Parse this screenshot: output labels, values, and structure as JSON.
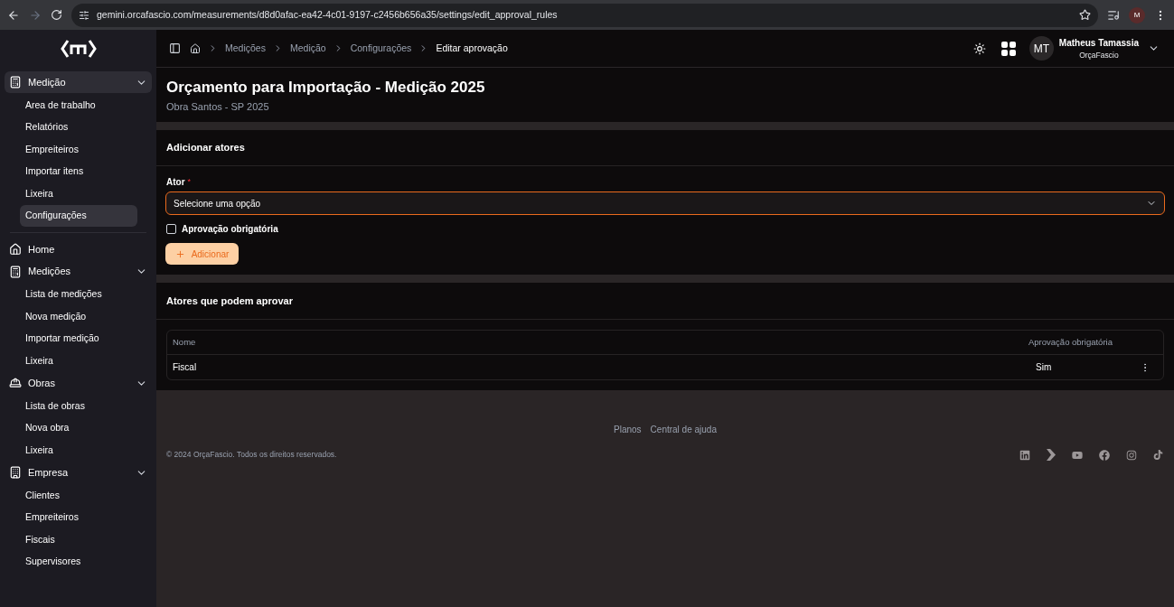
{
  "browser": {
    "url": "gemini.orcafascio.com/measurements/d8d0afac-ea42-4c01-9197-c2456b656a35/settings/edit_approval_rules",
    "profile": "M",
    "forward_disabled": true
  },
  "sidebar": {
    "sections": [
      {
        "label": "Medição",
        "kind": "calculator",
        "expanded": true,
        "selected": true,
        "children": [
          {
            "label": "Area de trabalho",
            "selected": false
          },
          {
            "label": "Relatórios",
            "selected": false
          },
          {
            "label": "Empreiteiros",
            "selected": false
          },
          {
            "label": "Importar itens",
            "selected": false
          },
          {
            "label": "Lixeira",
            "selected": false
          },
          {
            "label": "Configurações",
            "selected": true
          }
        ]
      },
      {
        "label": "Home",
        "kind": "home",
        "selected": false
      },
      {
        "label": "Medições",
        "kind": "calculator",
        "expanded": true,
        "selected": false,
        "children": [
          {
            "label": "Lista de medições",
            "selected": false
          },
          {
            "label": "Nova medição",
            "selected": false
          },
          {
            "label": "Importar medição",
            "selected": false
          },
          {
            "label": "Lixeira",
            "selected": false
          }
        ]
      },
      {
        "label": "Obras",
        "kind": "helmet",
        "expanded": true,
        "selected": false,
        "children": [
          {
            "label": "Lista de obras",
            "selected": false
          },
          {
            "label": "Nova obra",
            "selected": false
          },
          {
            "label": "Lixeira",
            "selected": false
          }
        ]
      },
      {
        "label": "Empresa",
        "kind": "building",
        "expanded": true,
        "selected": false,
        "children": [
          {
            "label": "Clientes",
            "selected": false
          },
          {
            "label": "Empreiteiros",
            "selected": false
          },
          {
            "label": "Fiscais",
            "selected": false
          },
          {
            "label": "Supervisores",
            "selected": false
          }
        ]
      }
    ]
  },
  "breadcrumbs": [
    "Medições",
    "Medição",
    "Configurações",
    "Editar aprovação"
  ],
  "user": {
    "initials": "MT",
    "name": "Matheus Tamassia",
    "company": "OrçaFascio"
  },
  "page": {
    "title": "Orçamento para Importação - Medição 2025",
    "subtitle": "Obra Santos - SP 2025"
  },
  "add_section": {
    "title": "Adicionar atores",
    "field_label": "Ator",
    "required_mark": "*",
    "select": {
      "placeholder": "Selecione uma opção",
      "focused": true
    },
    "checkbox": {
      "label": "Aprovação obrigatória",
      "checked": false
    },
    "button": "Adicionar"
  },
  "list_section": {
    "title": "Atores que podem aprovar",
    "table": {
      "columns": [
        "Nome",
        "Aprovação obrigatória"
      ],
      "rows": [
        [
          "Fiscal",
          "Sim"
        ]
      ]
    }
  },
  "footer": {
    "links": [
      "Planos",
      "Central de ajuda"
    ],
    "copyright": "© 2024 OrçaFascio. Todos os direitos reservados."
  }
}
